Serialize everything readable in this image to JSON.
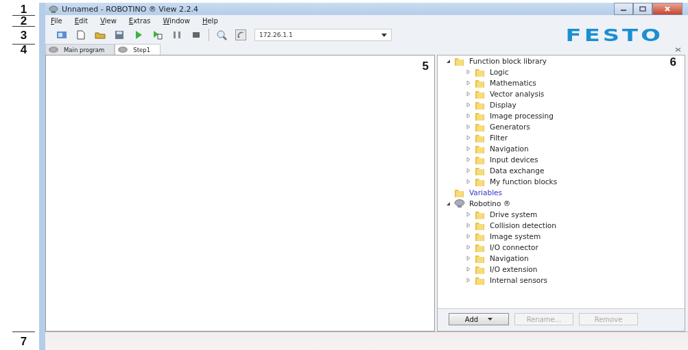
{
  "callouts": [
    "1",
    "2",
    "3",
    "4",
    "7"
  ],
  "pane_callouts": {
    "editor": "5",
    "library": "6"
  },
  "window": {
    "title": "Unnamed - ROBOTINO ® View 2.2.4"
  },
  "menu": [
    "File",
    "Edit",
    "View",
    "Extras",
    "Window",
    "Help"
  ],
  "toolbar": {
    "address": "172.26.1.1",
    "logo": "FESTO"
  },
  "tabs": [
    {
      "label": "Main program",
      "selected": false
    },
    {
      "label": "Step1",
      "selected": true
    }
  ],
  "tree": [
    {
      "label": "Function block library",
      "kind": "folder",
      "expanded": true,
      "children": [
        {
          "label": "Logic",
          "kind": "folder",
          "expanded": false
        },
        {
          "label": "Mathematics",
          "kind": "folder",
          "expanded": false
        },
        {
          "label": "Vector analysis",
          "kind": "folder",
          "expanded": false
        },
        {
          "label": "Display",
          "kind": "folder",
          "expanded": false
        },
        {
          "label": "Image processing",
          "kind": "folder",
          "expanded": false
        },
        {
          "label": "Generators",
          "kind": "folder",
          "expanded": false
        },
        {
          "label": "Filter",
          "kind": "folder",
          "expanded": false
        },
        {
          "label": "Navigation",
          "kind": "folder",
          "expanded": false
        },
        {
          "label": "Input devices",
          "kind": "folder",
          "expanded": false
        },
        {
          "label": "Data exchange",
          "kind": "folder",
          "expanded": false
        },
        {
          "label": "My function blocks",
          "kind": "folder",
          "expanded": false
        }
      ]
    },
    {
      "label": "Variables",
      "kind": "variables"
    },
    {
      "label": "Robotino ®",
      "kind": "robot",
      "expanded": true,
      "children": [
        {
          "label": "Drive system",
          "kind": "folder",
          "expanded": false
        },
        {
          "label": "Collision detection",
          "kind": "folder",
          "expanded": false
        },
        {
          "label": "Image system",
          "kind": "folder",
          "expanded": false
        },
        {
          "label": "I/O connector",
          "kind": "folder",
          "expanded": false
        },
        {
          "label": "Navigation",
          "kind": "folder",
          "expanded": false
        },
        {
          "label": "I/O extension",
          "kind": "folder",
          "expanded": false
        },
        {
          "label": "Internal sensors",
          "kind": "folder",
          "expanded": false
        }
      ]
    }
  ],
  "buttons": [
    {
      "label": "Add",
      "dropdown": true,
      "disabled": false
    },
    {
      "label": "Rename...",
      "dropdown": false,
      "disabled": true
    },
    {
      "label": "Remove",
      "dropdown": false,
      "disabled": true
    }
  ]
}
